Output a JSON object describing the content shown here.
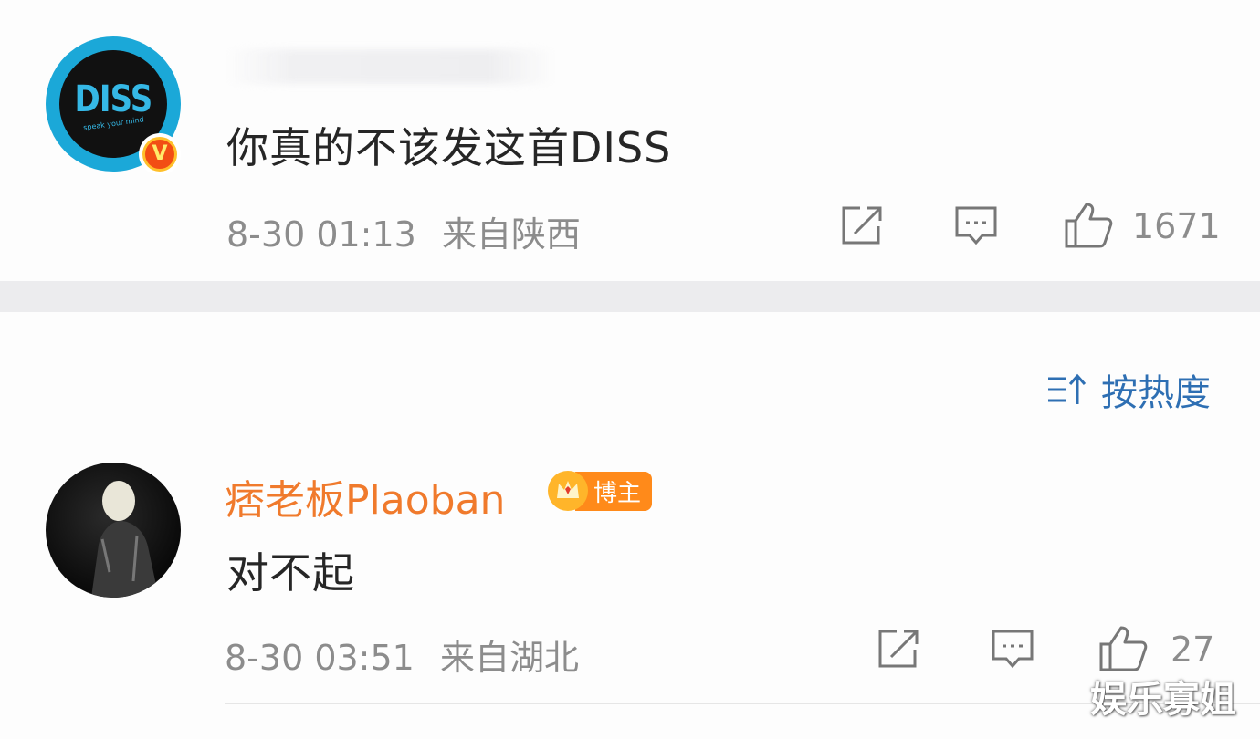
{
  "comment": {
    "avatar": {
      "text": "DISS",
      "subtext": "speak your mind",
      "badge": "V"
    },
    "text": "你真的不该发这首DISS",
    "time": "8-30 01:13",
    "location": "来自陕西",
    "likes": "1671"
  },
  "sort": {
    "label": "按热度",
    "icon": "sort-icon"
  },
  "reply": {
    "username": "痞老板Plaoban",
    "badge_label": "博主",
    "text": "对不起",
    "time": "8-30 03:51",
    "location": "来自湖北",
    "likes": "27"
  },
  "watermark": "娱乐寡姐",
  "colors": {
    "username": "#f07a2c",
    "sort": "#2e6fb3",
    "meta": "#8c8c8c",
    "badge": "#ff8a1a",
    "avatar_ring": "#1ba8d8"
  }
}
